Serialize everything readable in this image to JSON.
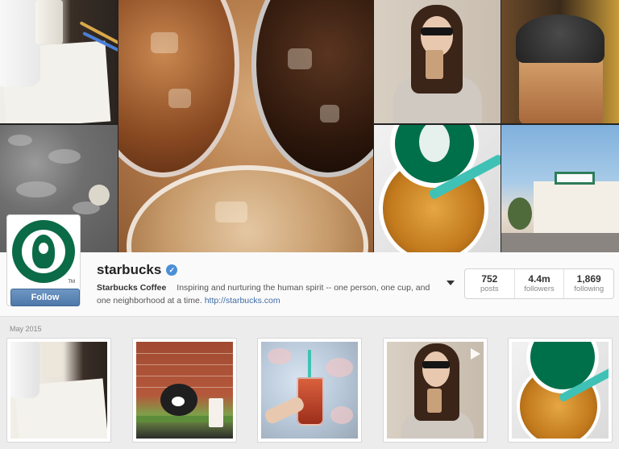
{
  "profile": {
    "username": "starbucks",
    "full_name": "Starbucks Coffee",
    "bio": "Inspiring and nurturing the human spirit -- one person, one cup, and one neighborhood at a time.",
    "link": "http://starbucks.com",
    "follow_label": "Follow",
    "verified_icon": "verified-badge-icon",
    "avatar_mark": "TM"
  },
  "stats": [
    {
      "value": "752",
      "label": "posts"
    },
    {
      "value": "4.4m",
      "label": "followers"
    },
    {
      "value": "1,869",
      "label": "following"
    }
  ],
  "feed": {
    "month_label": "May 2015",
    "posts": [
      {
        "name": "post-cup-sketch",
        "video": false
      },
      {
        "name": "post-dog-bench",
        "video": false
      },
      {
        "name": "post-blossom-drink",
        "video": false
      },
      {
        "name": "post-girl-drink",
        "video": true
      },
      {
        "name": "post-iced-coffee-logo",
        "video": false
      }
    ]
  },
  "colors": {
    "follow_button": "#4e78a8",
    "link": "#3f6da6",
    "starbucks_green": "#00704a",
    "verified": "#4b8fd6"
  }
}
